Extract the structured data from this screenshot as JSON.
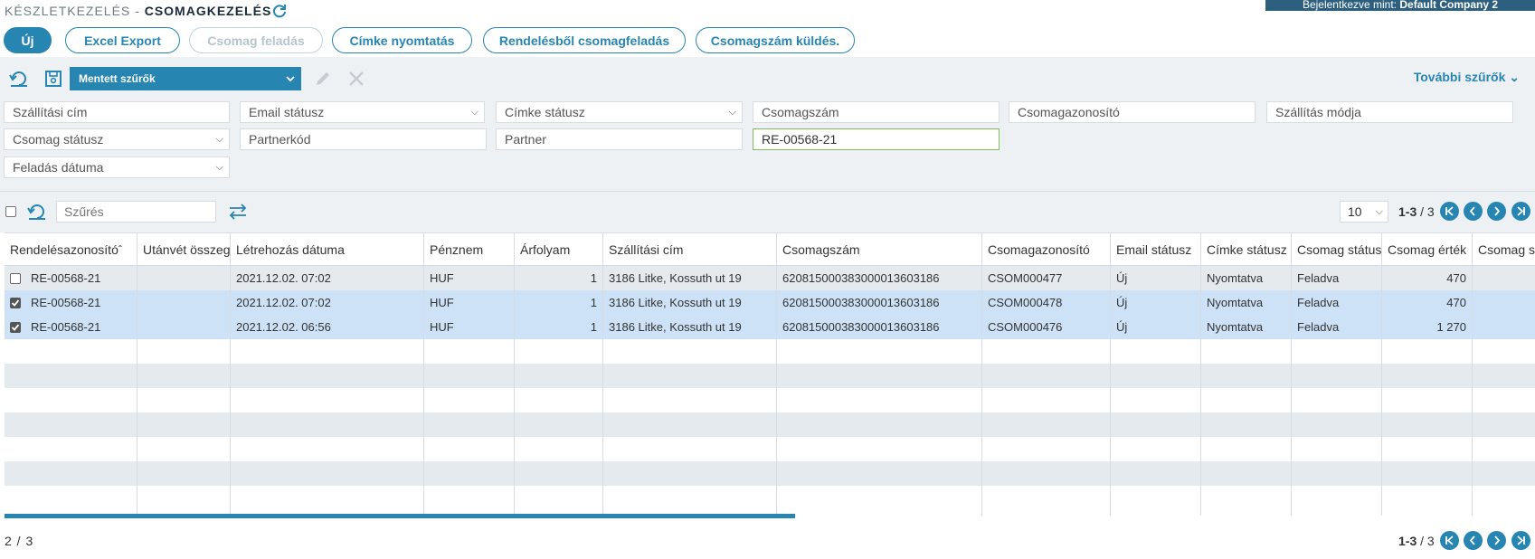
{
  "header": {
    "breadcrumb_parent": "KÉSZLETKEZELÉS -",
    "breadcrumb_current": "CSOMAGKEZELÉS",
    "login_prefix": "Bejelentkezve mint:",
    "login_company": "Default Company 2"
  },
  "toolbar": {
    "new_label": "Új",
    "excel_label": "Excel Export",
    "send_package_label": "Csomag feladás",
    "label_print_label": "Címke nyomtatás",
    "order_package_label": "Rendelésből csomagfeladás",
    "tracking_send_label": "Csomagszám küldés."
  },
  "filters": {
    "saved_filters_label": "Mentett szűrők",
    "more_filters_label": "További szűrők",
    "shipping_address": "Szállítási cím",
    "email_status": "Email státusz",
    "label_status": "Címke státusz",
    "package_number": "Csomagszám",
    "package_id": "Csomagazonosító",
    "shipping_method": "Szállítás módja",
    "package_status": "Csomag státusz",
    "partner_code": "Partnerkód",
    "partner": "Partner",
    "order_id_value": "RE-00568-21",
    "send_date": "Feladás dátuma"
  },
  "grid_toolbar": {
    "search_placeholder": "Szűrés",
    "page_size": "10",
    "pager_range": "1-3",
    "pager_total": "/ 3"
  },
  "columns": [
    "Rendelésazonosító",
    "Utánvét összeg",
    "Létrehozás dátuma",
    "Pénznem",
    "Árfolyam",
    "Szállítási cím",
    "Csomagszám",
    "Csomagazonosító",
    "Email státusz",
    "Címke státusz",
    "Csomag státusz",
    "Csomag érték",
    "Csomag súly"
  ],
  "rows": [
    {
      "checked": false,
      "order": "RE-00568-21",
      "cod": "",
      "created": "2021.12.02. 07:02",
      "currency": "HUF",
      "rate": "1",
      "address": "3186 Litke, Kossuth ut 19",
      "number": "62081500038300001360318​6",
      "pkgid": "CSOM000477",
      "email": "Új",
      "label": "Nyomtatva",
      "status": "Feladva",
      "value": "470",
      "weight": ""
    },
    {
      "checked": true,
      "order": "RE-00568-21",
      "cod": "",
      "created": "2021.12.02. 07:02",
      "currency": "HUF",
      "rate": "1",
      "address": "3186 Litke, Kossuth ut 19",
      "number": "62081500038300001360318​6",
      "pkgid": "CSOM000478",
      "email": "Új",
      "label": "Nyomtatva",
      "status": "Feladva",
      "value": "470",
      "weight": ""
    },
    {
      "checked": true,
      "order": "RE-00568-21",
      "cod": "",
      "created": "2021.12.02. 06:56",
      "currency": "HUF",
      "rate": "1",
      "address": "3186 Litke, Kossuth ut 19",
      "number": "62081500038300001360318​6",
      "pkgid": "CSOM000476",
      "email": "Új",
      "label": "Nyomtatva",
      "status": "Feladva",
      "value": "1 270",
      "weight": ""
    }
  ],
  "footer": {
    "selection_count": "2 / 3"
  }
}
